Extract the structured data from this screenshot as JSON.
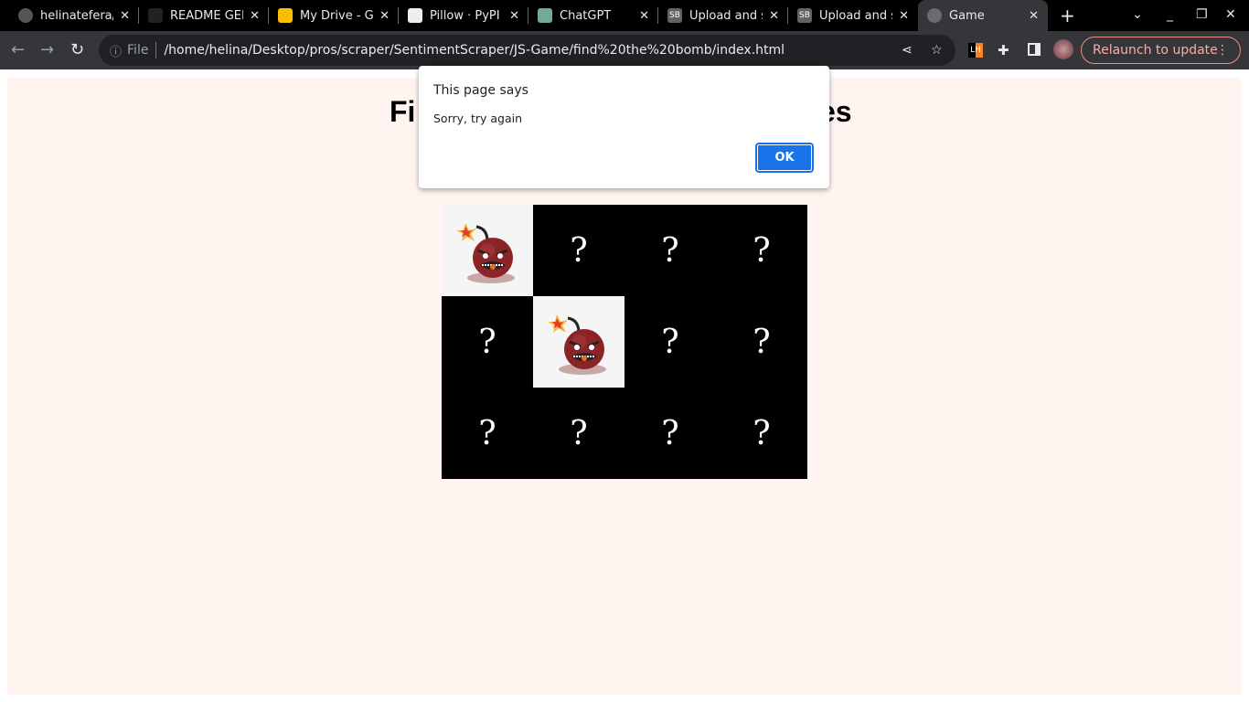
{
  "tabs": [
    {
      "title": "helinatefera/",
      "icon": "github-icon",
      "color": "#555"
    },
    {
      "title": "README GEN",
      "icon": "readme-icon",
      "color": "#222"
    },
    {
      "title": "My Drive - Go",
      "icon": "google-drive-icon",
      "color": "#fbbc04"
    },
    {
      "title": "Pillow · PyPI",
      "icon": "pypi-icon",
      "color": "#eee"
    },
    {
      "title": "ChatGPT",
      "icon": "chatgpt-icon",
      "color": "#74aa9c"
    },
    {
      "title": "Upload and s",
      "icon": "sb-icon",
      "color": "#5f6368",
      "badge": "SB"
    },
    {
      "title": "Upload and s",
      "icon": "sb-icon",
      "color": "#5f6368",
      "badge": "SB"
    },
    {
      "title": "Game",
      "icon": "globe-icon",
      "color": "#6b6b6b",
      "active": true
    }
  ],
  "omnibox": {
    "scheme_label": "File",
    "url": "/home/helina/Desktop/pros/scraper/SentimentScraper/JS-Game/find%20the%20bomb/index.html"
  },
  "relaunch_label": "Relaunch to update",
  "page": {
    "title_left": "Fi",
    "title_right": "es",
    "grid": [
      [
        "bomb",
        "?",
        "?",
        "?"
      ],
      [
        "?",
        "bomb",
        "?",
        "?"
      ],
      [
        "?",
        "?",
        "?",
        "?"
      ]
    ]
  },
  "dialog": {
    "title": "This page says",
    "message": "Sorry, try again",
    "ok_label": "OK"
  },
  "colors": {
    "page_bg": "#fff4ef",
    "accent": "#1a73e8",
    "relaunch": "#f28b82"
  }
}
